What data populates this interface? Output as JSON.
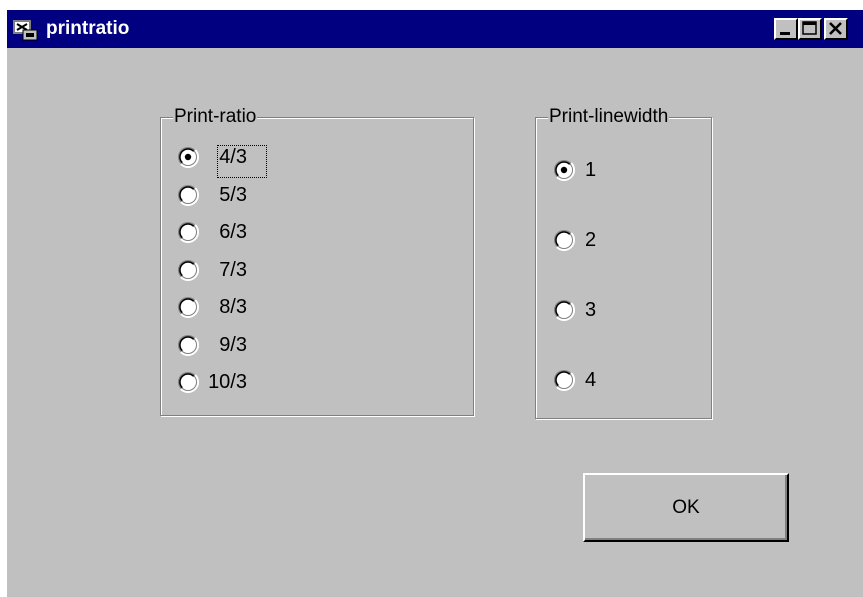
{
  "window": {
    "title": "printratio",
    "colors": {
      "titlebar": "#000080",
      "face": "#c0c0c0"
    }
  },
  "print_ratio": {
    "legend": "Print-ratio",
    "selected": "4/3",
    "options": [
      "4/3",
      "5/3",
      "6/3",
      "7/3",
      "8/3",
      "9/3",
      "10/3"
    ]
  },
  "print_linewidth": {
    "legend": "Print-linewidth",
    "selected": "1",
    "options": [
      "1",
      "2",
      "3",
      "4"
    ]
  },
  "buttons": {
    "ok": "OK"
  }
}
